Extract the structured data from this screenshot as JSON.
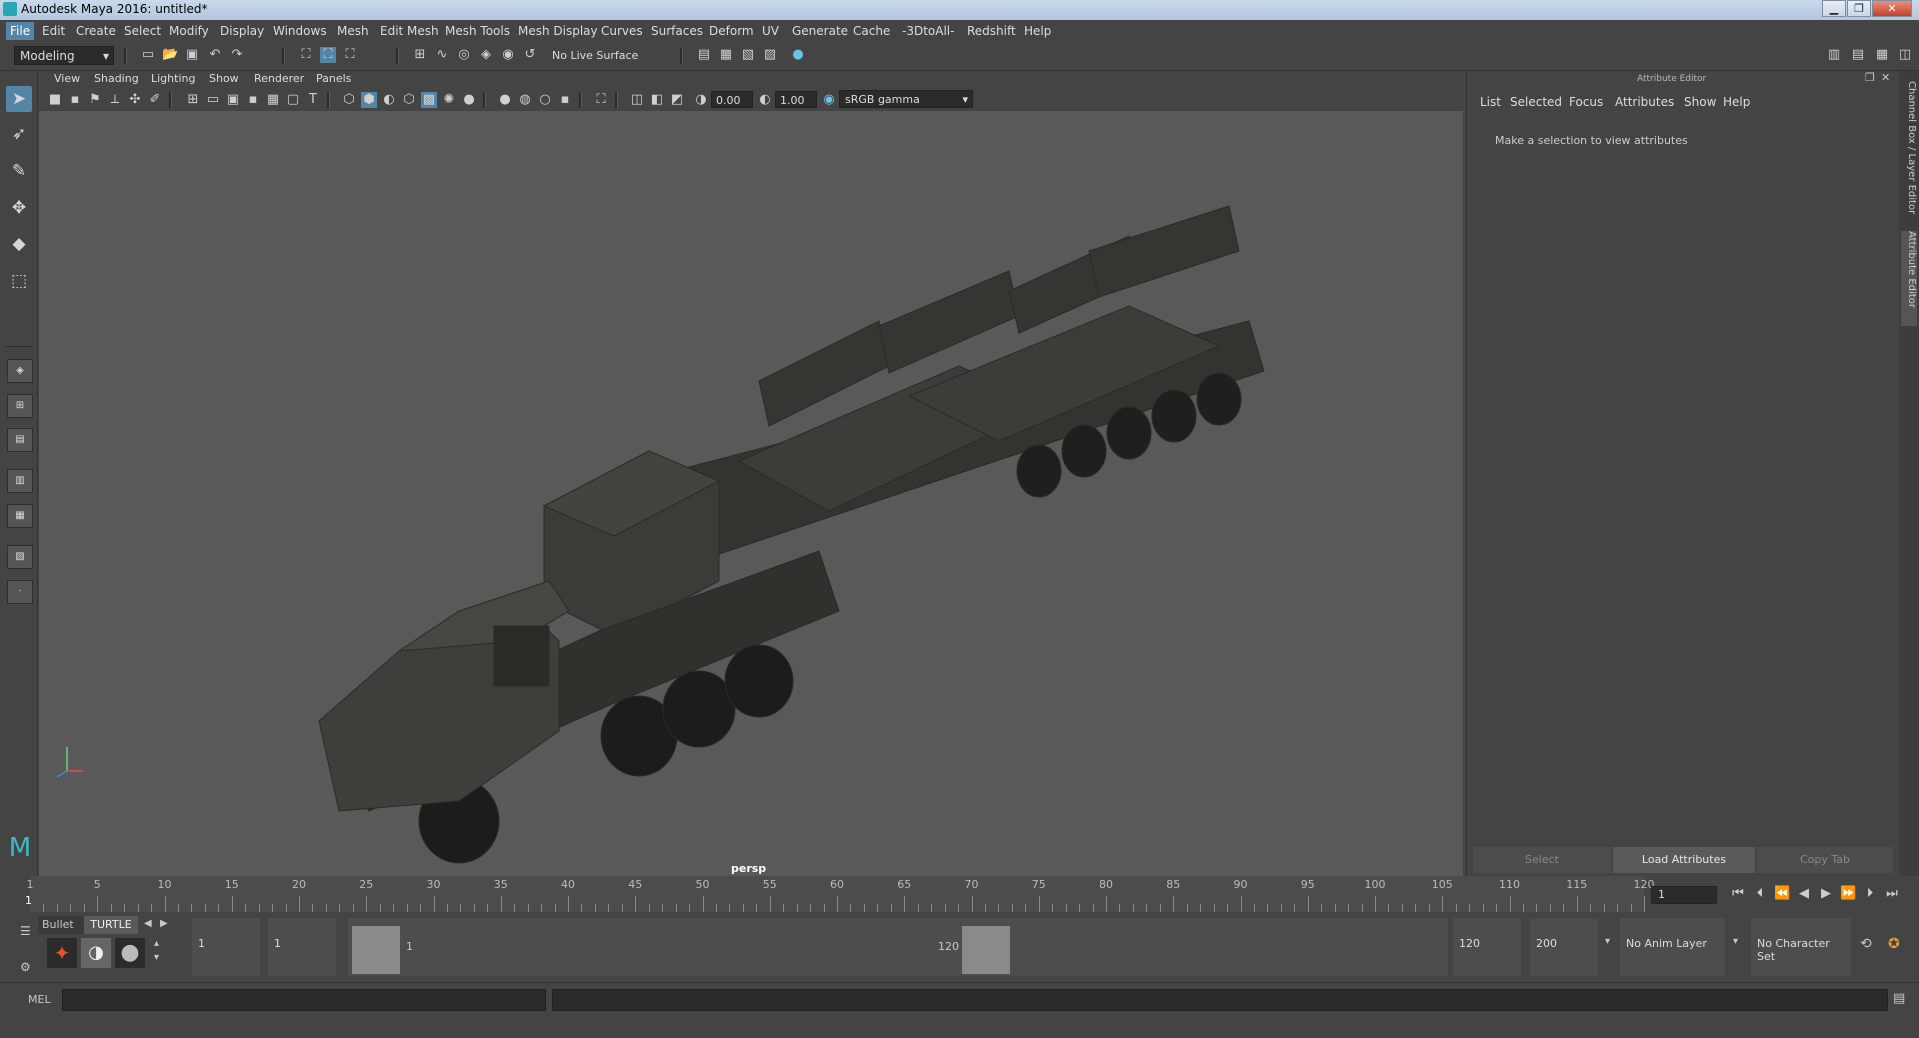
{
  "window": {
    "title": "Autodesk Maya 2016: untitled*",
    "controls": [
      "▁",
      "❐",
      "✕"
    ]
  },
  "menubar": {
    "items": [
      "File",
      "Edit",
      "Create",
      "Select",
      "Modify",
      "Display",
      "Windows",
      "Mesh",
      "Edit Mesh",
      "Mesh Tools",
      "Mesh Display",
      "Curves",
      "Surfaces",
      "Deform",
      "UV",
      "Generate",
      "Cache",
      "-3DtoAll-",
      "Redshift",
      "Help"
    ]
  },
  "toolbar": {
    "mode": "Modeling",
    "live_surface": "No Live Surface"
  },
  "viewport": {
    "menu": [
      "View",
      "Shading",
      "Lighting",
      "Show",
      "Renderer",
      "Panels"
    ],
    "exposure": "0.00",
    "gamma": "1.00",
    "color_space": "sRGB gamma",
    "camera_label": "persp"
  },
  "attribute_editor": {
    "header": "Attribute Editor",
    "menu": [
      "List",
      "Selected",
      "Focus",
      "Attributes",
      "Show",
      "Help"
    ],
    "message": "Make a selection to view attributes",
    "buttons": {
      "select": "Select",
      "load": "Load Attributes",
      "copy": "Copy Tab"
    }
  },
  "side_tabs": {
    "channel_box": "Channel Box / Layer Editor",
    "attribute_editor": "Attribute Editor"
  },
  "timeslider": {
    "labels": [
      "1",
      "5",
      "10",
      "15",
      "20",
      "25",
      "30",
      "35",
      "40",
      "45",
      "50",
      "55",
      "60",
      "65",
      "70",
      "75",
      "80",
      "85",
      "90",
      "95",
      "100",
      "105",
      "110",
      "115",
      "120"
    ],
    "current_frame": "1"
  },
  "range": {
    "shelf_tabs": [
      "Bullet",
      "TURTLE"
    ],
    "start": "1",
    "playback_start": "1",
    "range_start_label": "1",
    "range_end_label": "120",
    "playback_end": "120",
    "end": "200",
    "anim_layer": "No Anim Layer",
    "character_set": "No Character Set"
  },
  "commandline": {
    "label": "MEL"
  },
  "colors": {
    "accent": "#5285a6",
    "viewport_bg": "#595959",
    "vehicle": "#3a3a36"
  }
}
